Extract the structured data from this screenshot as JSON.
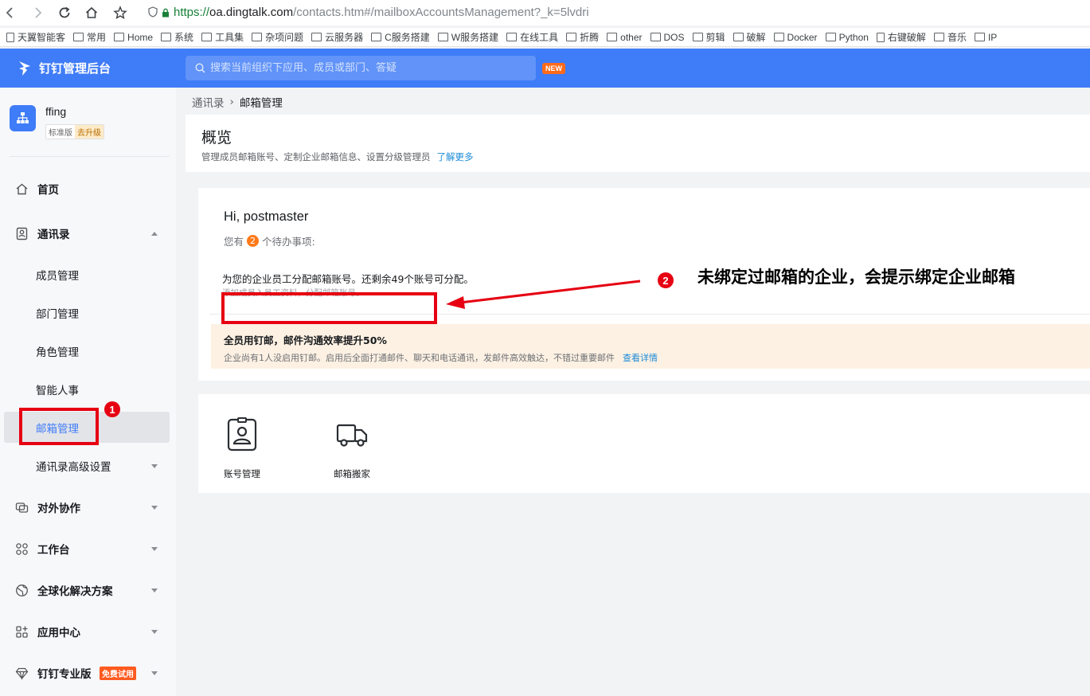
{
  "browser": {
    "url_scheme": "https://",
    "url_host": "oa.dingtalk.com",
    "url_path": "/contacts.htm#/mailboxAccountsManagement?_k=5lvdri"
  },
  "bookmarks": [
    {
      "label": "天翼智能客",
      "type": "page"
    },
    {
      "label": "常用",
      "type": "folder"
    },
    {
      "label": "Home",
      "type": "folder"
    },
    {
      "label": "系统",
      "type": "folder"
    },
    {
      "label": "工具集",
      "type": "folder"
    },
    {
      "label": "杂项问题",
      "type": "folder"
    },
    {
      "label": "云服务器",
      "type": "folder"
    },
    {
      "label": "C服务搭建",
      "type": "folder"
    },
    {
      "label": "W服务搭建",
      "type": "folder"
    },
    {
      "label": "在线工具",
      "type": "folder"
    },
    {
      "label": "折腾",
      "type": "folder"
    },
    {
      "label": "other",
      "type": "folder"
    },
    {
      "label": "DOS",
      "type": "folder"
    },
    {
      "label": "剪辑",
      "type": "folder"
    },
    {
      "label": "破解",
      "type": "folder"
    },
    {
      "label": "Docker",
      "type": "folder"
    },
    {
      "label": "Python",
      "type": "folder"
    },
    {
      "label": "右键破解",
      "type": "page"
    },
    {
      "label": "音乐",
      "type": "folder"
    },
    {
      "label": "IP",
      "type": "folder"
    }
  ],
  "header": {
    "app_title": "钉钉管理后台",
    "search_placeholder": "搜索当前组织下应用、成员或部门、答疑",
    "new_badge": "NEW",
    "accent": "#3f7cf7"
  },
  "org": {
    "name": "ffing",
    "edition": "标准版",
    "upgrade": "去升级"
  },
  "sidebar": {
    "items": [
      {
        "label": "首页"
      },
      {
        "label": "通讯录"
      },
      {
        "label": "成员管理"
      },
      {
        "label": "部门管理"
      },
      {
        "label": "角色管理"
      },
      {
        "label": "智能人事"
      },
      {
        "label": "邮箱管理"
      },
      {
        "label": "通讯录高级设置"
      },
      {
        "label": "对外协作"
      },
      {
        "label": "工作台"
      },
      {
        "label": "全球化解决方案"
      },
      {
        "label": "应用中心"
      },
      {
        "label": "钉钉专业版"
      }
    ],
    "pro_badge": "免费试用"
  },
  "breadcrumb": {
    "root": "通讯录",
    "current": "邮箱管理"
  },
  "overview": {
    "title": "概览",
    "desc": "管理成员邮箱账号、定制企业邮箱信息、设置分级管理员",
    "link": "了解更多"
  },
  "card": {
    "greeting": "Hi, postmaster",
    "todo_prefix": "您有",
    "todo_count": "2",
    "todo_suffix": "个待办事项:",
    "task_title": "为您的企业员工分配邮箱账号。还剩余49个账号可分配。",
    "task_sub": "添加成员入员工资料，分配邮箱账号。",
    "promo_title": "全员用钉邮，邮件沟通效率提升50%",
    "promo_desc": "企业尚有1人没启用钉邮。启用后全面打通邮件、聊天和电话通讯，发邮件高效触达，不错过重要邮件",
    "promo_link": "查看详情"
  },
  "tools": [
    {
      "label": "账号管理",
      "icon": "account-card-icon"
    },
    {
      "label": "邮箱搬家",
      "icon": "truck-icon"
    }
  ],
  "annotations": {
    "num1": "1",
    "num2": "2",
    "note": "未绑定过邮箱的企业，会提示绑定企业邮箱",
    "color": "#e60012"
  }
}
